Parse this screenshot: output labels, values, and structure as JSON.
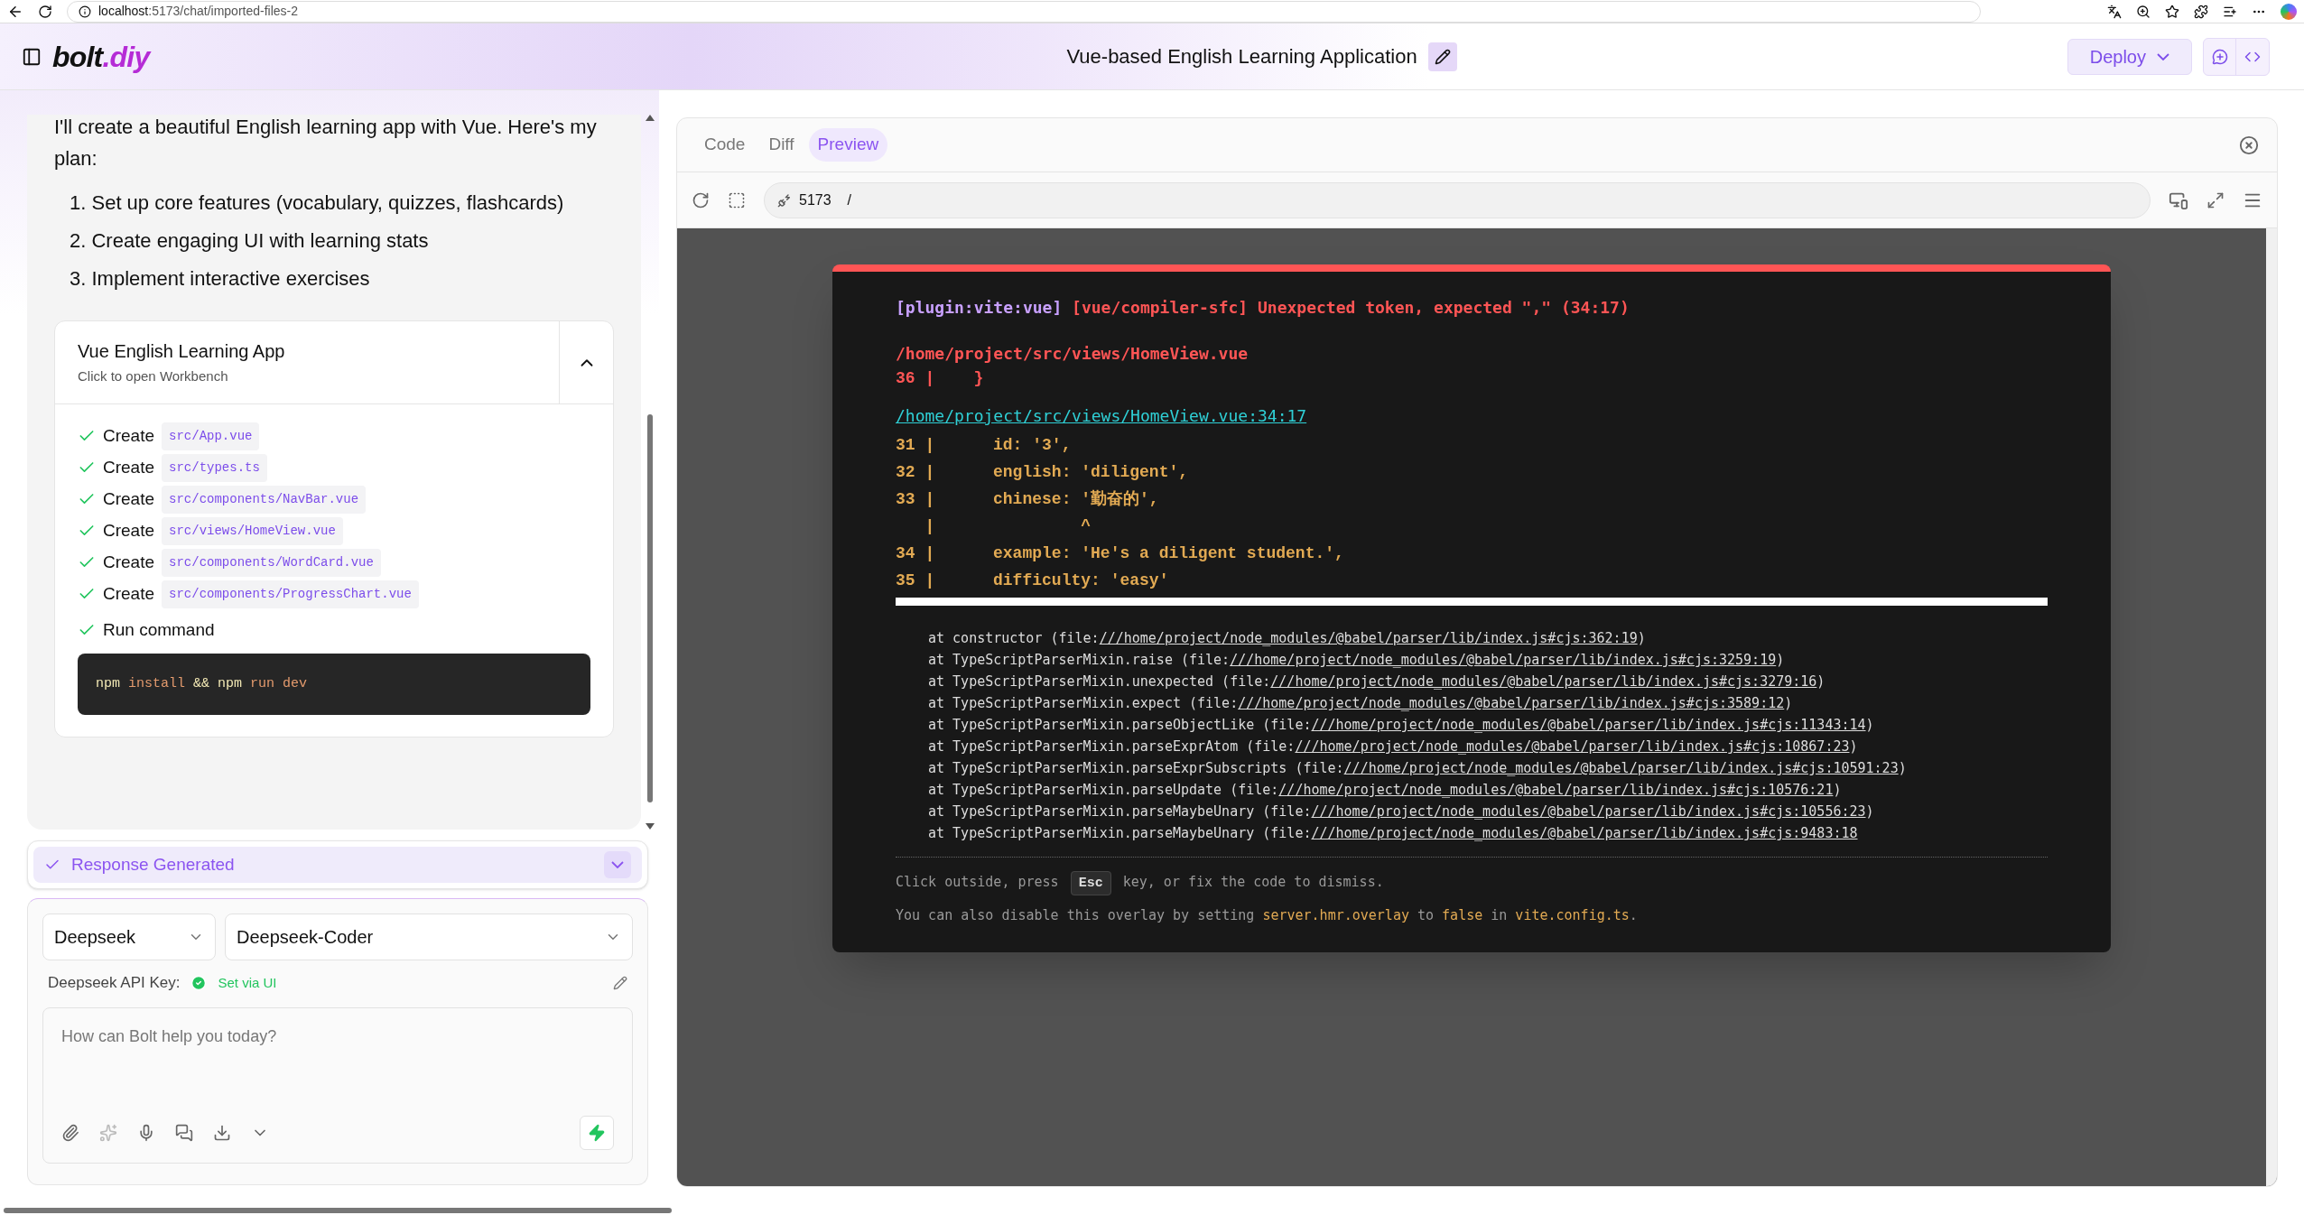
{
  "browser": {
    "url_host": "localhost",
    "url_rest": ":5173/chat/imported-files-2"
  },
  "header": {
    "logo": {
      "brand": "bolt",
      "suffix": ".diy"
    },
    "title": "Vue-based English Learning Application",
    "deploy": "Deploy"
  },
  "chat": {
    "intro": "I'll create a beautiful English learning app with Vue. Here's my plan:",
    "plan": [
      {
        "number": "1.",
        "text": "Set up core features (vocabulary, quizzes, flashcards)"
      },
      {
        "number": "2.",
        "text": "Create engaging UI with learning stats"
      },
      {
        "number": "3.",
        "text": "Implement interactive exercises"
      }
    ],
    "artifact": {
      "title": "Vue English Learning App",
      "subtitle": "Click to open Workbench",
      "expanded": true,
      "actions": [
        {
          "kind": "file",
          "label": "Create",
          "path": "src/App.vue"
        },
        {
          "kind": "file",
          "label": "Create",
          "path": "src/types.ts"
        },
        {
          "kind": "file",
          "label": "Create",
          "path": "src/components/NavBar.vue"
        },
        {
          "kind": "file",
          "label": "Create",
          "path": "src/views/HomeView.vue"
        },
        {
          "kind": "file",
          "label": "Create",
          "path": "src/components/WordCard.vue"
        },
        {
          "kind": "file",
          "label": "Create",
          "path": "src/components/ProgressChart.vue"
        },
        {
          "kind": "command",
          "label": "Run command",
          "command": [
            {
              "text": "npm",
              "kind": "cmd"
            },
            {
              "text": "install",
              "kind": "arg"
            },
            {
              "text": "&&",
              "kind": "cmd"
            },
            {
              "text": "npm",
              "kind": "cmd"
            },
            {
              "text": "run",
              "kind": "arg"
            },
            {
              "text": "dev",
              "kind": "arg"
            }
          ]
        }
      ]
    }
  },
  "status": {
    "label": "Response Generated",
    "expanded": false
  },
  "composer": {
    "provider": "Deepseek",
    "model": "Deepseek-Coder",
    "api_key_label": "Deepseek API Key:",
    "api_key_status": "Set via UI",
    "placeholder": "How can Bolt help you today?"
  },
  "workbench": {
    "tabs": [
      {
        "label": "Code",
        "selected": false
      },
      {
        "label": "Diff",
        "selected": false
      },
      {
        "label": "Preview",
        "selected": true
      }
    ],
    "port": "5173",
    "path": "/",
    "overlay": {
      "plugin": "[plugin:vite:vue]",
      "message": "[vue/compiler-sfc] Unexpected token, expected \",\" (34:17)",
      "file": "/home/project/src/views/HomeView.vue",
      "error_line": "36 |    }",
      "location": "/home/project/src/views/HomeView.vue:34:17",
      "frame": [
        "31 |      id: '3',",
        "32 |      english: 'diligent',",
        "33 |      chinese: '勤奋的',",
        "   |               ^",
        "34 |      example: 'He's a diligent student.',",
        "35 |      difficulty: 'easy'"
      ],
      "stack": [
        {
          "prefix": "at constructor (file:",
          "link": "///home/project/node_modules/@babel/parser/lib/index.js#cjs:362:19",
          "suffix": ")"
        },
        {
          "prefix": "at TypeScriptParserMixin.raise (file:",
          "link": "///home/project/node_modules/@babel/parser/lib/index.js#cjs:3259:19",
          "suffix": ")"
        },
        {
          "prefix": "at TypeScriptParserMixin.unexpected (file:",
          "link": "///home/project/node_modules/@babel/parser/lib/index.js#cjs:3279:16",
          "suffix": ")"
        },
        {
          "prefix": "at TypeScriptParserMixin.expect (file:",
          "link": "///home/project/node_modules/@babel/parser/lib/index.js#cjs:3589:12",
          "suffix": ")"
        },
        {
          "prefix": "at TypeScriptParserMixin.parseObjectLike (file:",
          "link": "///home/project/node_modules/@babel/parser/lib/index.js#cjs:11343:14",
          "suffix": ")"
        },
        {
          "prefix": "at TypeScriptParserMixin.parseExprAtom (file:",
          "link": "///home/project/node_modules/@babel/parser/lib/index.js#cjs:10867:23",
          "suffix": ")"
        },
        {
          "prefix": "at TypeScriptParserMixin.parseExprSubscripts (file:",
          "link": "///home/project/node_modules/@babel/parser/lib/index.js#cjs:10591:23",
          "suffix": ")"
        },
        {
          "prefix": "at TypeScriptParserMixin.parseUpdate (file:",
          "link": "///home/project/node_modules/@babel/parser/lib/index.js#cjs:10576:21",
          "suffix": ")"
        },
        {
          "prefix": "at TypeScriptParserMixin.parseMaybeUnary (file:",
          "link": "///home/project/node_modules/@babel/parser/lib/index.js#cjs:10556:23",
          "suffix": ")"
        },
        {
          "prefix": "at TypeScriptParserMixin.parseMaybeUnary (file:",
          "link": "///home/project/node_modules/@babel/parser/lib/index.js#cjs:9483:18"
        }
      ],
      "tip1": [
        {
          "kind": "plain",
          "text": "Click outside, press "
        },
        {
          "kind": "key",
          "text": "Esc"
        },
        {
          "kind": "plain",
          "text": " key, or fix the code to dismiss."
        }
      ],
      "tip2": [
        {
          "kind": "plain",
          "text": "You can also disable this overlay by setting "
        },
        {
          "kind": "highlight",
          "text": "server.hmr.overlay"
        },
        {
          "kind": "plain",
          "text": " to "
        },
        {
          "kind": "highlight",
          "text": "false"
        },
        {
          "kind": "plain",
          "text": " in "
        },
        {
          "kind": "highlight",
          "text": "vite.config.ts"
        },
        {
          "kind": "plain",
          "text": "."
        }
      ]
    }
  }
}
